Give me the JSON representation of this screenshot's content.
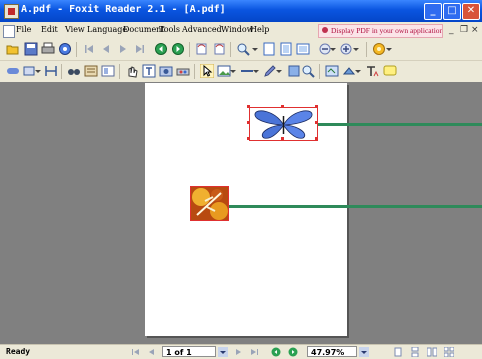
{
  "window": {
    "title": "A.pdf - Foxit Reader 2.1 - [A.pdf]"
  },
  "menu": {
    "items": [
      "File",
      "Edit",
      "View",
      "Language",
      "Document",
      "Tools",
      "Advanced",
      "Window",
      "Help"
    ],
    "promo": "Display PDF in your own applications",
    "mdi_minimize": "_",
    "mdi_restore": "❐",
    "mdi_close": "×"
  },
  "statusbar": {
    "status": "Ready",
    "page_indicator": "1 of 1",
    "zoom": "47.97%"
  },
  "colors": {
    "titlebar": "#0a55e0",
    "selection": "#e03030",
    "annotation_arrow": "#2e8a5a",
    "canvas": "#808080"
  }
}
